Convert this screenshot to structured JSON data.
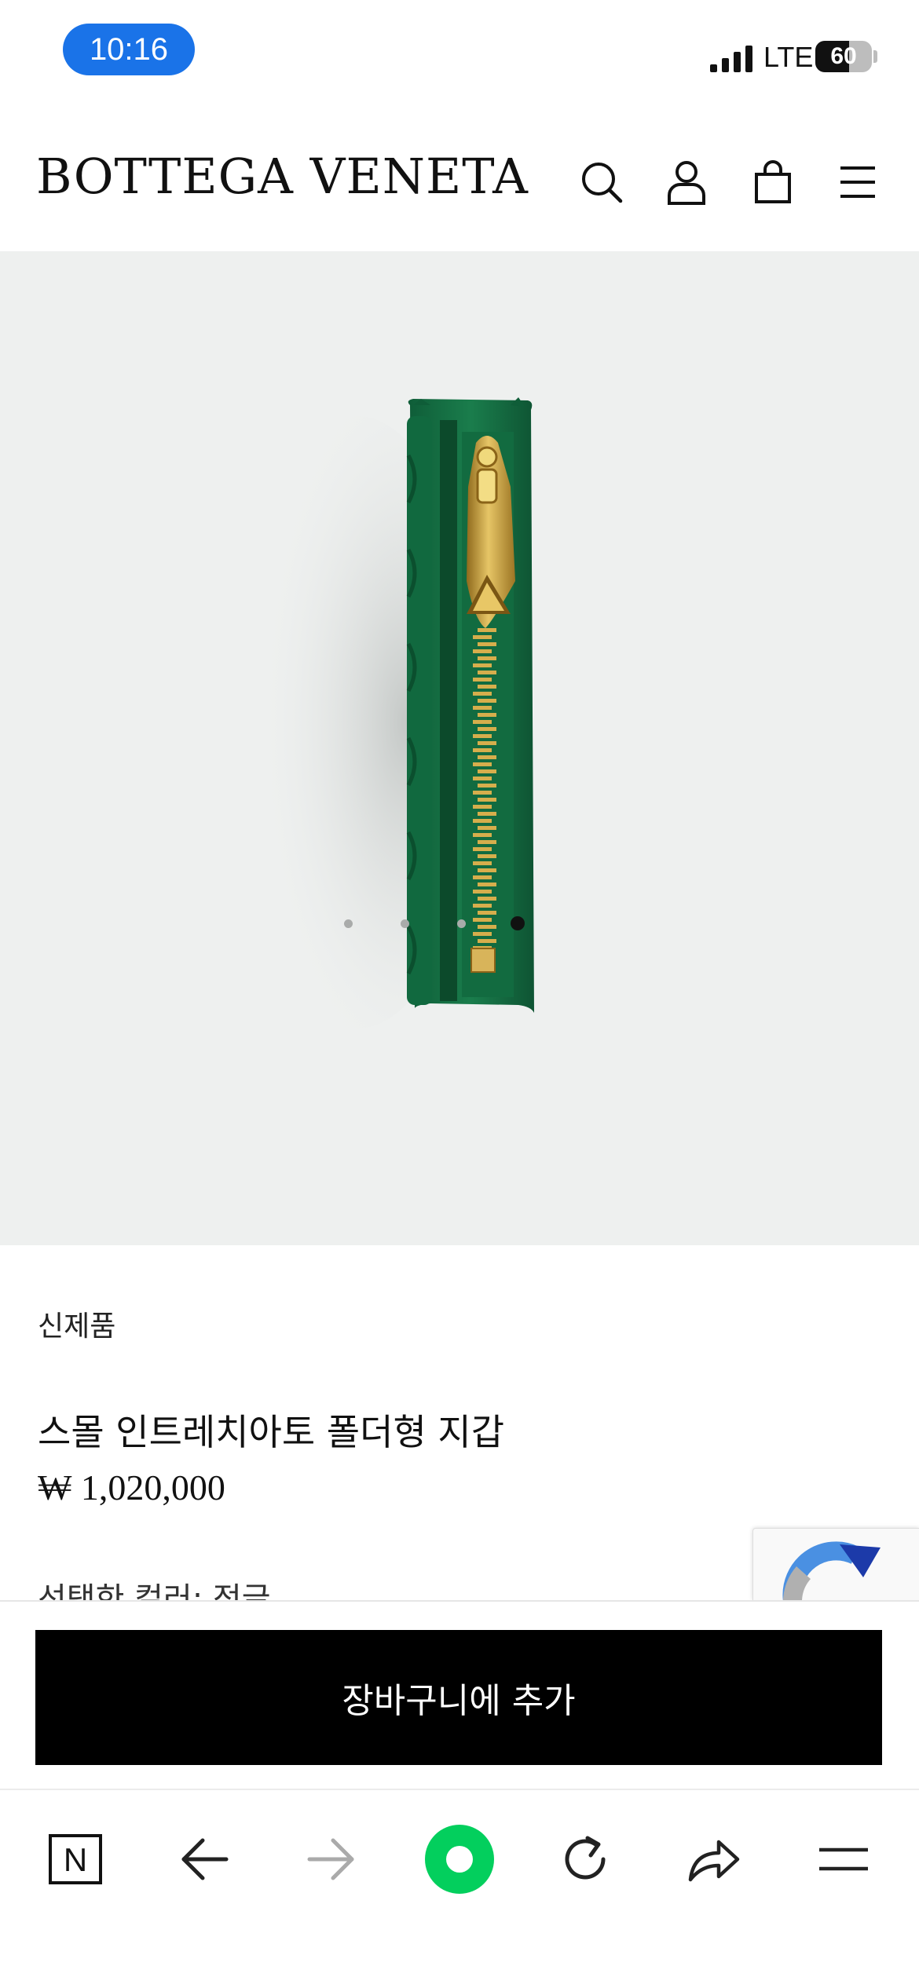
{
  "status_bar": {
    "time": "10:16",
    "network": "LTE",
    "battery": "60",
    "battery_level": 0.6
  },
  "header": {
    "logo": "BOTTEGA VENETA",
    "icons": [
      "search-icon",
      "account-icon",
      "shopping-bag-icon",
      "menu-icon"
    ]
  },
  "gallery": {
    "image_count": 4,
    "active_index": 3
  },
  "product": {
    "badge": "신제품",
    "name": "스몰 인트레치아토 폴더형 지갑",
    "price": "₩ 1,020,000",
    "color_line": "선택한 컬러: 정글"
  },
  "cart": {
    "add_label": "장바구니에 추가"
  },
  "browser_bar": {
    "home_letter": "N",
    "icons": [
      "naver-home-icon",
      "back-arrow-icon",
      "forward-arrow-icon",
      "green-dot-icon",
      "reload-icon",
      "share-icon",
      "menu-lines-icon"
    ]
  },
  "colors": {
    "time_pill": "#1a73e8",
    "hero_bg": "#eef0ef",
    "wallet_green": "#17784a",
    "zipper_gold": "#c9a23a",
    "naver_green": "#03cf5d",
    "cart_button": "#000000"
  }
}
